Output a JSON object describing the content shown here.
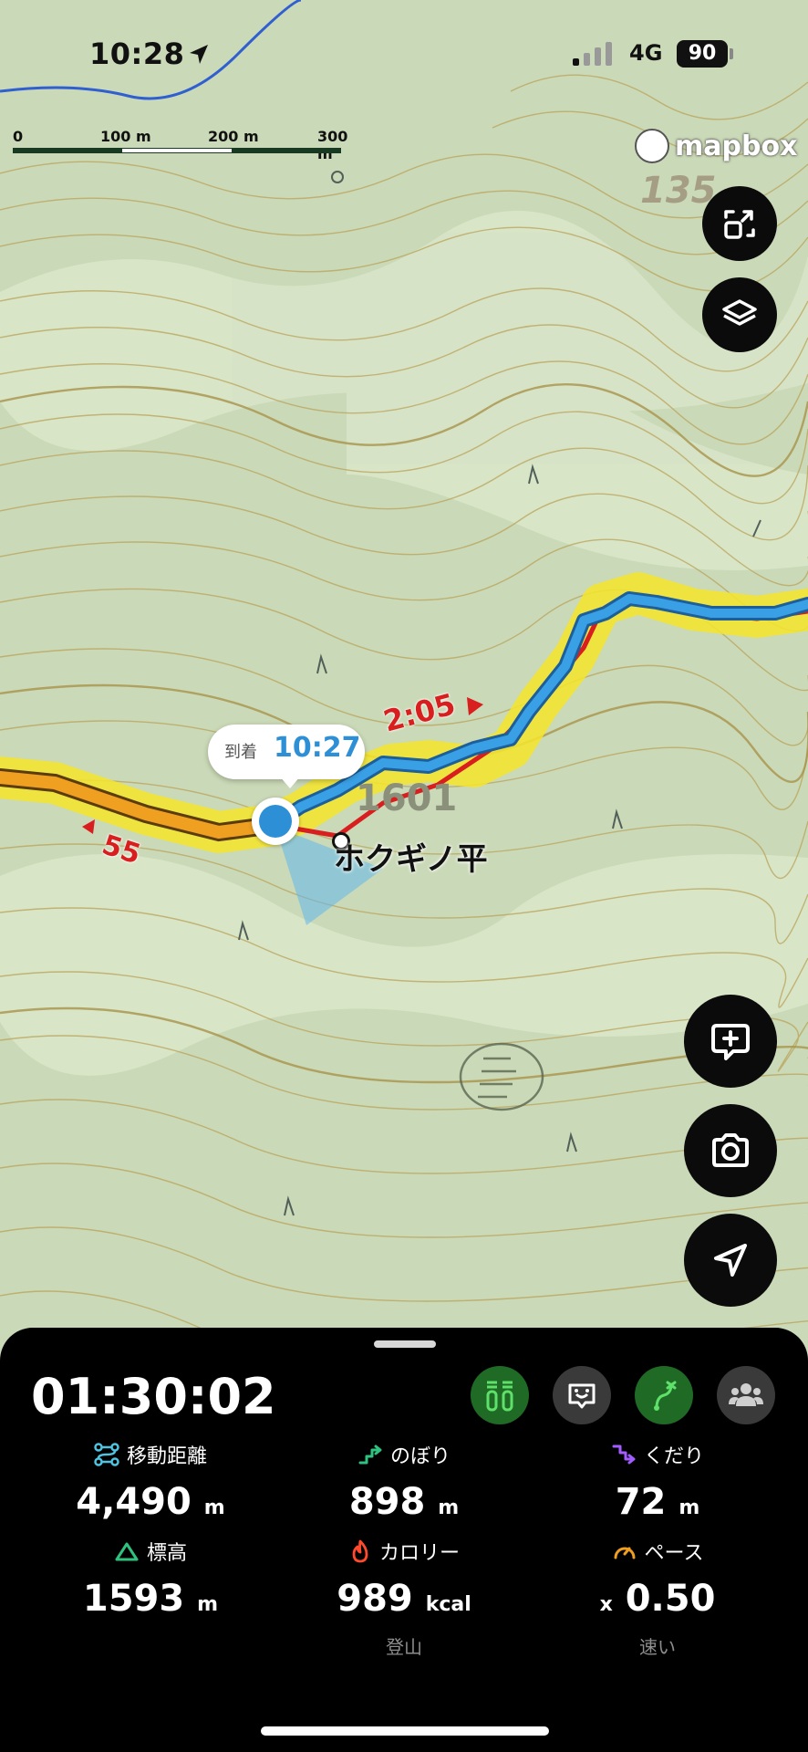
{
  "status_bar": {
    "time": "10:28",
    "network": "4G",
    "battery": "90"
  },
  "map": {
    "scale_labels": [
      "0",
      "100 m",
      "200 m",
      "300 m"
    ],
    "attribution": "mapbox",
    "elevation_label_top": "135",
    "elevation_label_mid": "1601",
    "route_label_forward": "2:05",
    "route_label_back": "55",
    "place_name": "ホクギノ平",
    "arrival": {
      "label": "到着",
      "time": "10:27"
    }
  },
  "panel": {
    "elapsed": "01:30:02",
    "stats": [
      {
        "label": "移動距離",
        "value": "4,490",
        "unit": "m",
        "icon": "route-distance-icon",
        "color": "#4fc3e0"
      },
      {
        "label": "のぼり",
        "value": "898",
        "unit": "m",
        "icon": "ascent-icon",
        "color": "#2ec27e"
      },
      {
        "label": "くだり",
        "value": "72",
        "unit": "m",
        "icon": "descent-icon",
        "color": "#a25cff"
      },
      {
        "label": "標高",
        "value": "1593",
        "unit": "m",
        "icon": "mountain-icon",
        "color": "#2ec27e"
      },
      {
        "label": "カロリー",
        "value": "989",
        "unit": "kcal",
        "icon": "flame-icon",
        "color": "#ff4a2e",
        "sub": "登山"
      },
      {
        "label": "ペース",
        "value": "0.50",
        "prefix": "x",
        "icon": "speedometer-icon",
        "color": "#f0a020",
        "sub": "速い"
      }
    ]
  },
  "colors": {
    "map_green": "#cfdcbf",
    "route_blue": "#2d8fd5",
    "route_orange": "#f0a020",
    "highlight_yellow": "#f6e52a"
  }
}
